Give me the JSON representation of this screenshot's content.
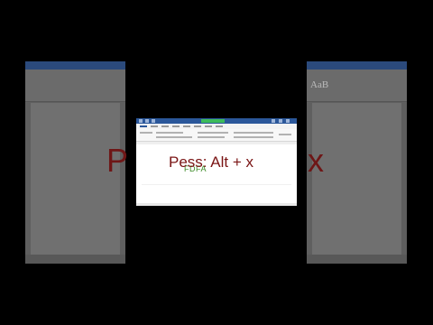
{
  "overlay": {
    "press_text": "Pess: Alt + x",
    "bg_left_fragment": "P",
    "bg_right_fragment": "x"
  },
  "document": {
    "typed_text": "FDFA"
  },
  "background_window": {
    "style_sample": "AaB"
  },
  "colors": {
    "title_bar": "#2b579a",
    "overlay_text": "#7a1414",
    "typed_text": "#3a8a25"
  }
}
